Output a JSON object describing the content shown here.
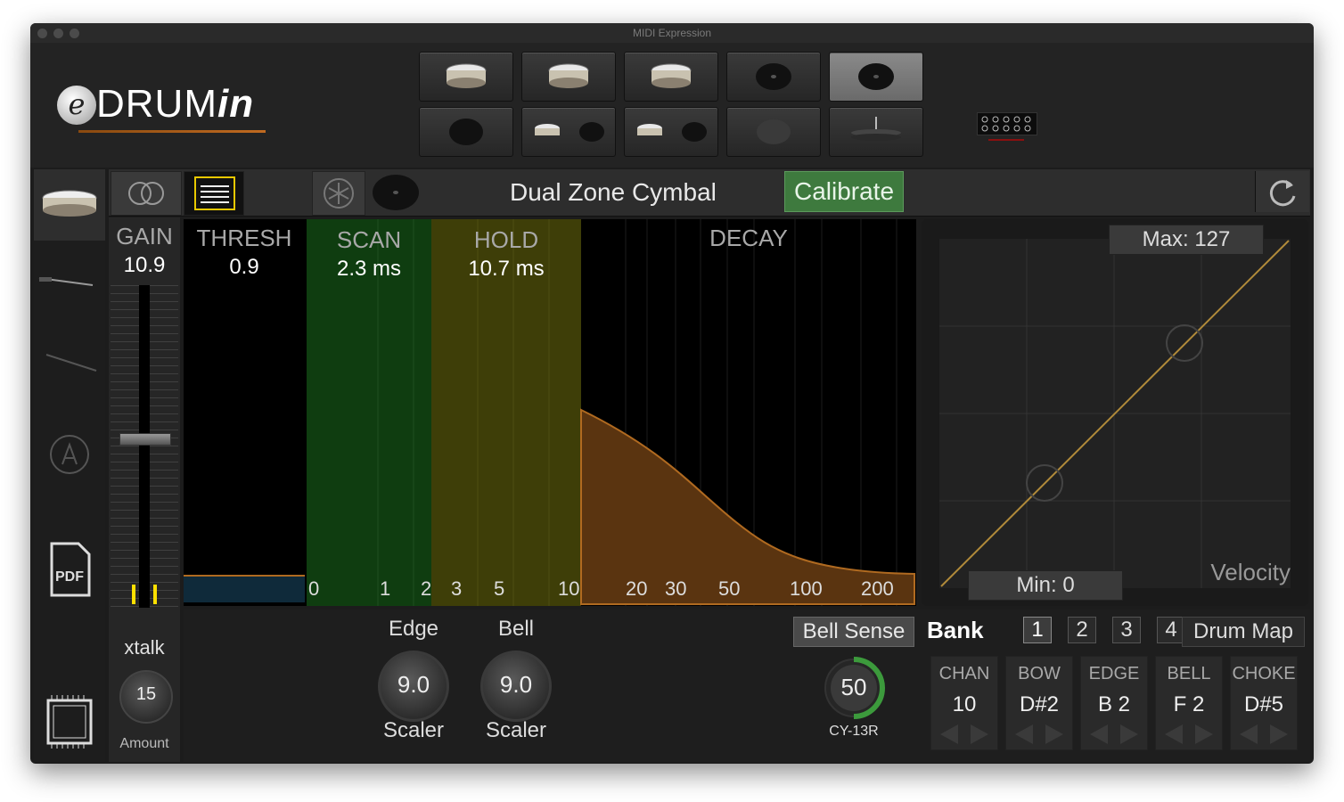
{
  "window": {
    "title": "MIDI Expression"
  },
  "logo": {
    "e": "e",
    "drum": "DRUM",
    "in": "in"
  },
  "toolbar": {
    "instrument_name": "Dual Zone Cymbal",
    "calibrate_label": "Calibrate"
  },
  "gain": {
    "label": "GAIN",
    "value": "10.9"
  },
  "thresh": {
    "label": "THRESH",
    "value": "0.9"
  },
  "scan": {
    "label": "SCAN",
    "value": "2.3 ms"
  },
  "hold": {
    "label": "HOLD",
    "value": "10.7 ms"
  },
  "decay": {
    "label": "DECAY"
  },
  "time_ticks": [
    "0",
    "1",
    "2",
    "3",
    "5",
    "10",
    "20",
    "30",
    "50",
    "100",
    "200"
  ],
  "xtalk": {
    "label": "xtalk",
    "amount_value": "15",
    "amount_label": "Amount"
  },
  "curve": {
    "max_label": "Max: 127",
    "min_label": "Min: 0",
    "axis_label": "Velocity"
  },
  "edge_scaler": {
    "title": "Edge",
    "value": "9.0",
    "label": "Scaler"
  },
  "bell_scaler": {
    "title": "Bell",
    "value": "9.0",
    "label": "Scaler"
  },
  "bell_sense": {
    "label": "Bell Sense",
    "value": "50",
    "model": "CY-13R",
    "level_fraction": 0.5
  },
  "bank": {
    "label": "Bank",
    "buttons": [
      "1",
      "2",
      "3",
      "4"
    ],
    "selected": "1"
  },
  "drum_map_label": "Drum Map",
  "mapping": [
    {
      "header": "CHAN",
      "value": "10"
    },
    {
      "header": "BOW",
      "value": "D#2"
    },
    {
      "header": "EDGE",
      "value": "B 2"
    },
    {
      "header": "BELL",
      "value": "F 2"
    },
    {
      "header": "CHOKE",
      "value": "D#5"
    }
  ],
  "pads": [
    {
      "icon": "snare-drum-icon"
    },
    {
      "icon": "tom-drum-icon"
    },
    {
      "icon": "tom-drum-icon"
    },
    {
      "icon": "cymbal-icon"
    },
    {
      "icon": "cymbal-icon",
      "selected": true
    },
    {
      "icon": "kick-pad-icon"
    },
    {
      "icon": "drum-cymbal-combo-icon"
    },
    {
      "icon": "drum-cymbal-combo-icon"
    },
    {
      "icon": "cymbal-dim-icon"
    },
    {
      "icon": "hihat-icon"
    }
  ],
  "sidebar": [
    "drum-icon",
    "stick-icon",
    "line-icon",
    "auto-icon",
    "pdf-icon",
    "chip-icon"
  ],
  "colors": {
    "scan": "#0f3d10",
    "hold": "#3e3e08",
    "decay": "#5a3410",
    "curve": "#b08a3a",
    "accent_green": "#3e7a3e"
  }
}
